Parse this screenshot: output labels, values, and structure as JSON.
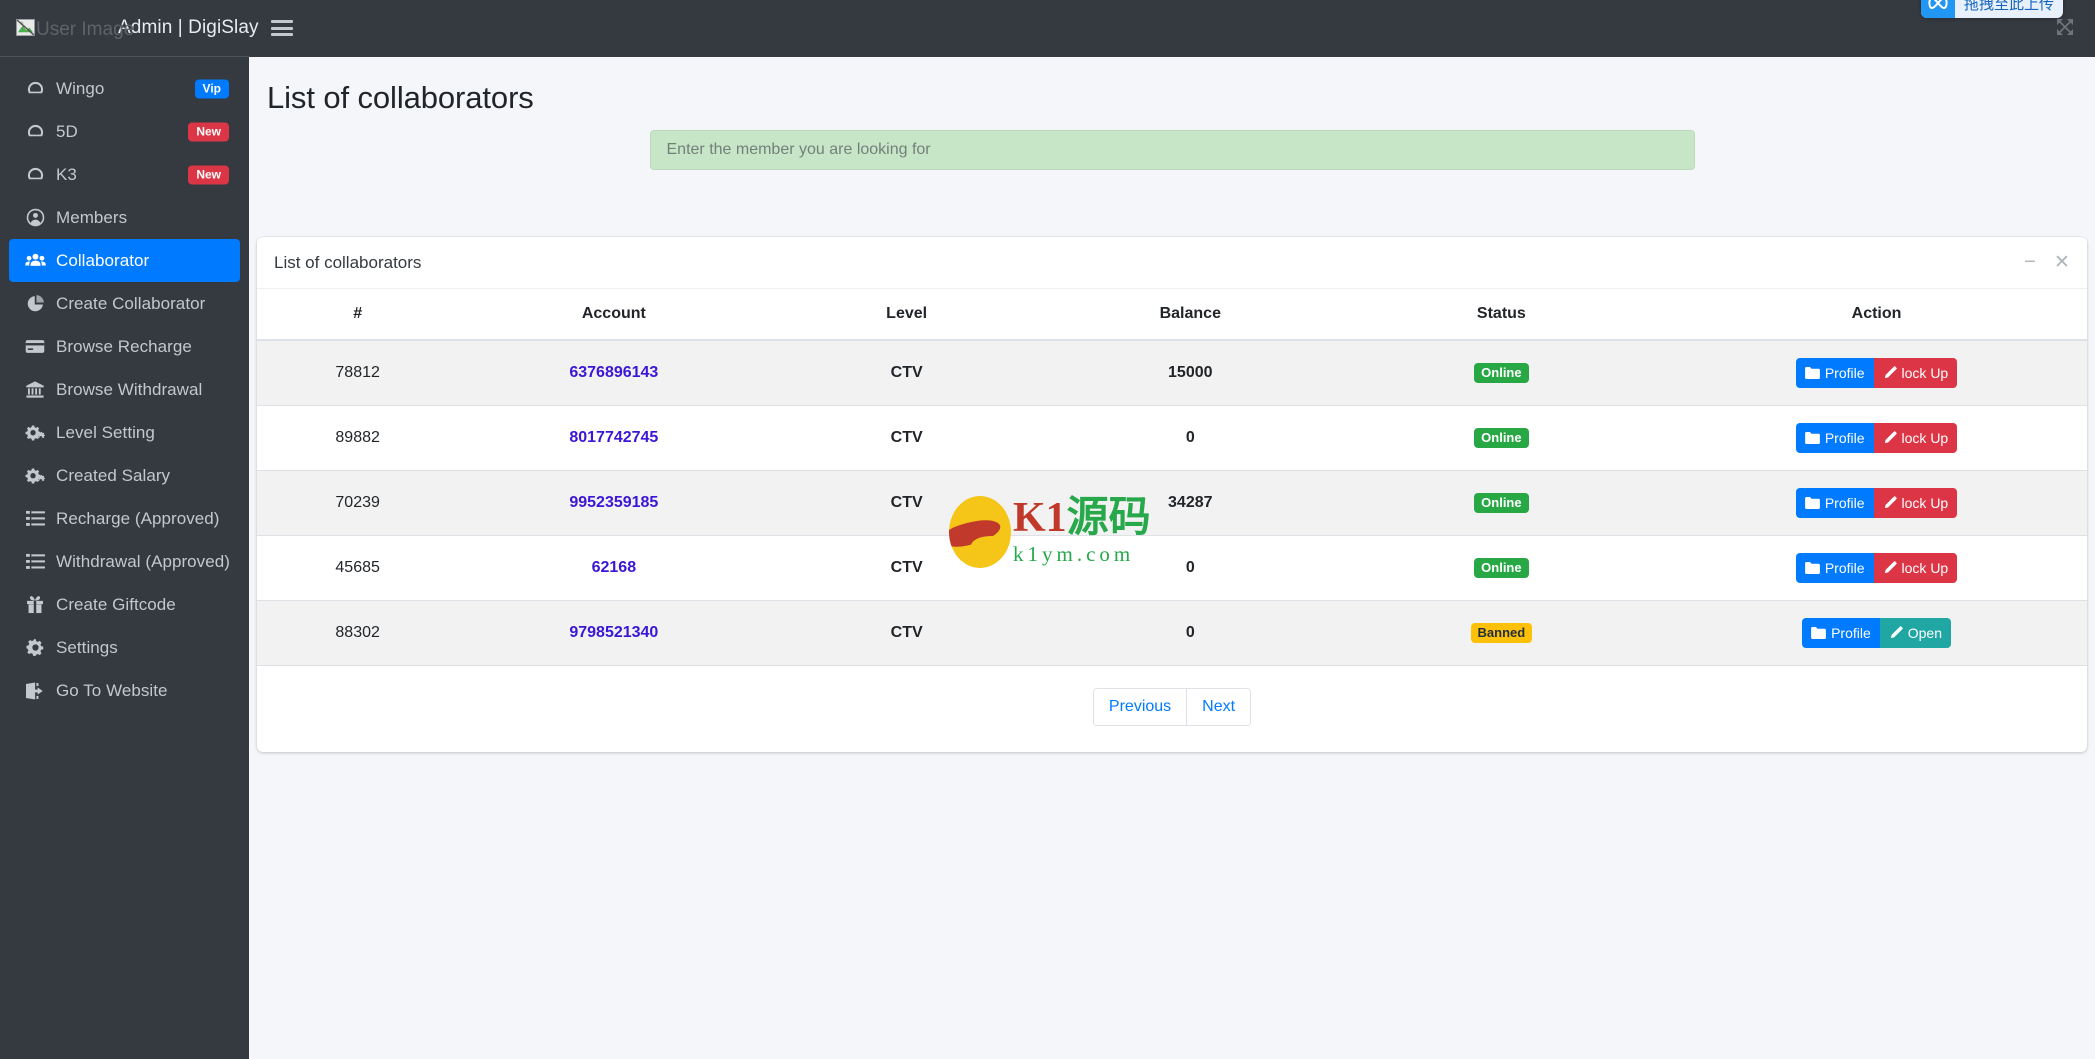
{
  "sidebar": {
    "brand": {
      "image_alt": "User Image",
      "title": "Admin | DigiSlay"
    },
    "items": [
      {
        "label": "Wingo",
        "icon": "dashboard-icon",
        "badge": "Vip",
        "badge_kind": "vip",
        "active": false
      },
      {
        "label": "5D",
        "icon": "dashboard-icon",
        "badge": "New",
        "badge_kind": "new",
        "active": false
      },
      {
        "label": "K3",
        "icon": "dashboard-icon",
        "badge": "New",
        "badge_kind": "new",
        "active": false
      },
      {
        "label": "Members",
        "icon": "user-circle-icon",
        "badge": "",
        "badge_kind": "",
        "active": false
      },
      {
        "label": "Collaborator",
        "icon": "users-group-icon",
        "badge": "",
        "badge_kind": "",
        "active": true
      },
      {
        "label": "Create Collaborator",
        "icon": "pie-chart-icon",
        "badge": "",
        "badge_kind": "",
        "active": false
      },
      {
        "label": "Browse Recharge",
        "icon": "credit-card-icon",
        "badge": "",
        "badge_kind": "",
        "active": false
      },
      {
        "label": "Browse Withdrawal",
        "icon": "bank-icon",
        "badge": "",
        "badge_kind": "",
        "active": false
      },
      {
        "label": "Level Setting",
        "icon": "cogs-icon",
        "badge": "",
        "badge_kind": "",
        "active": false
      },
      {
        "label": "Created Salary",
        "icon": "cogs-icon",
        "badge": "",
        "badge_kind": "",
        "active": false
      },
      {
        "label": "Recharge (Approved)",
        "icon": "list-icon",
        "badge": "",
        "badge_kind": "",
        "active": false
      },
      {
        "label": "Withdrawal (Approved)",
        "icon": "list-icon",
        "badge": "",
        "badge_kind": "",
        "active": false
      },
      {
        "label": "Create Giftcode",
        "icon": "gift-icon",
        "badge": "",
        "badge_kind": "",
        "active": false
      },
      {
        "label": "Settings",
        "icon": "gear-icon",
        "badge": "",
        "badge_kind": "",
        "active": false
      },
      {
        "label": "Go To Website",
        "icon": "sign-out-icon",
        "badge": "",
        "badge_kind": "",
        "active": false
      }
    ]
  },
  "topnav": {
    "menu_toggle_icon": "hamburger-icon",
    "upload_badge": {
      "icon": "infinity-icon",
      "text": "拖拽至此上传"
    },
    "expand_icon": "expand-arrows-icon"
  },
  "page": {
    "title": "List of collaborators"
  },
  "search": {
    "placeholder": "Enter the member you are looking for",
    "value": ""
  },
  "card": {
    "title": "List of collaborators",
    "minimize_icon": "minus-icon",
    "close_icon": "close-icon"
  },
  "table": {
    "headers": [
      "#",
      "Account",
      "Level",
      "Balance",
      "Status",
      "Action"
    ],
    "rows": [
      {
        "id": "78812",
        "account": "6376896143",
        "level": "CTV",
        "balance": "15000",
        "status": "Online",
        "status_kind": "online",
        "actions": [
          {
            "label": "Profile",
            "icon": "folder-icon",
            "kind": "primary"
          },
          {
            "label": "lock Up",
            "icon": "pencil-icon",
            "kind": "danger"
          }
        ]
      },
      {
        "id": "89882",
        "account": "8017742745",
        "level": "CTV",
        "balance": "0",
        "status": "Online",
        "status_kind": "online",
        "actions": [
          {
            "label": "Profile",
            "icon": "folder-icon",
            "kind": "primary"
          },
          {
            "label": "lock Up",
            "icon": "pencil-icon",
            "kind": "danger"
          }
        ]
      },
      {
        "id": "70239",
        "account": "9952359185",
        "level": "CTV",
        "balance": "34287",
        "status": "Online",
        "status_kind": "online",
        "actions": [
          {
            "label": "Profile",
            "icon": "folder-icon",
            "kind": "primary"
          },
          {
            "label": "lock Up",
            "icon": "pencil-icon",
            "kind": "danger"
          }
        ]
      },
      {
        "id": "45685",
        "account": "62168",
        "level": "CTV",
        "balance": "0",
        "status": "Online",
        "status_kind": "online",
        "actions": [
          {
            "label": "Profile",
            "icon": "folder-icon",
            "kind": "primary"
          },
          {
            "label": "lock Up",
            "icon": "pencil-icon",
            "kind": "danger"
          }
        ]
      },
      {
        "id": "88302",
        "account": "9798521340",
        "level": "CTV",
        "balance": "0",
        "status": "Banned",
        "status_kind": "banned",
        "actions": [
          {
            "label": "Profile",
            "icon": "folder-icon",
            "kind": "primary"
          },
          {
            "label": "Open",
            "icon": "pencil-icon",
            "kind": "teal"
          }
        ]
      }
    ]
  },
  "pagination": {
    "previous": "Previous",
    "next": "Next"
  },
  "watermark": {
    "line1_part1": "K1",
    "line1_part2": "源码",
    "line2": "k1ym.com"
  },
  "colors": {
    "sidebar_bg": "#343a40",
    "accent_blue": "#007bff",
    "danger_red": "#dc3545",
    "teal": "#20a7a4",
    "success_green": "#28a745",
    "warning_yellow": "#ffc107",
    "search_green": "#c7e6c7",
    "account_link": "#3b16d6"
  }
}
